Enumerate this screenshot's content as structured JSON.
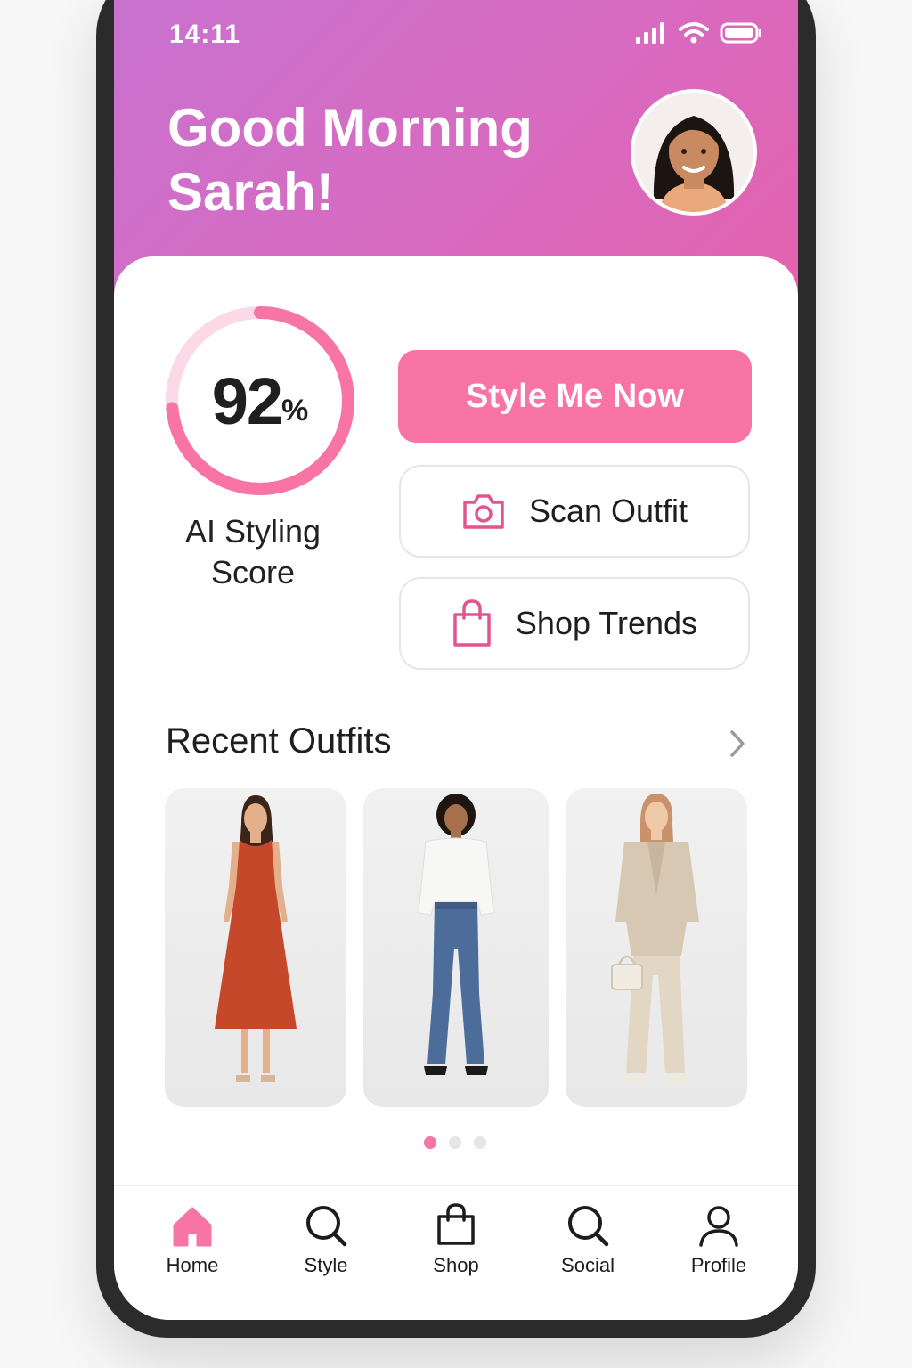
{
  "status": {
    "time": "14:11"
  },
  "header": {
    "greeting_line1": "Good Morning",
    "greeting_line2": "Sarah!",
    "avatar_icon": "user-avatar-photo"
  },
  "score": {
    "value": "92",
    "unit": "%",
    "fraction": 0.92,
    "label_line1": "AI Styling",
    "label_line2": "Score"
  },
  "actions": {
    "primary_label": "Style Me Now",
    "scan_label": "Scan Outfit",
    "scan_icon": "camera-icon",
    "shop_label": "Shop Trends",
    "shop_icon": "shopping-bag-icon"
  },
  "recent": {
    "title": "Recent Outfits",
    "items": [
      {
        "icon": "outfit-photo-rust-dress"
      },
      {
        "icon": "outfit-photo-white-shirt-jeans"
      },
      {
        "icon": "outfit-photo-beige-suit"
      }
    ],
    "page_count": 3,
    "current_page": 1
  },
  "nav": {
    "items": [
      {
        "label": "Home",
        "icon": "home-icon",
        "active": true
      },
      {
        "label": "Style",
        "icon": "search-icon"
      },
      {
        "label": "Shop",
        "icon": "shopping-bag-icon"
      },
      {
        "label": "Social",
        "icon": "search-icon"
      },
      {
        "label": "Profile",
        "icon": "user-icon"
      }
    ]
  },
  "colors": {
    "accent": "#f774a4",
    "header_start": "#c872cf",
    "header_end": "#e462ad",
    "text": "#1f1f1f"
  }
}
